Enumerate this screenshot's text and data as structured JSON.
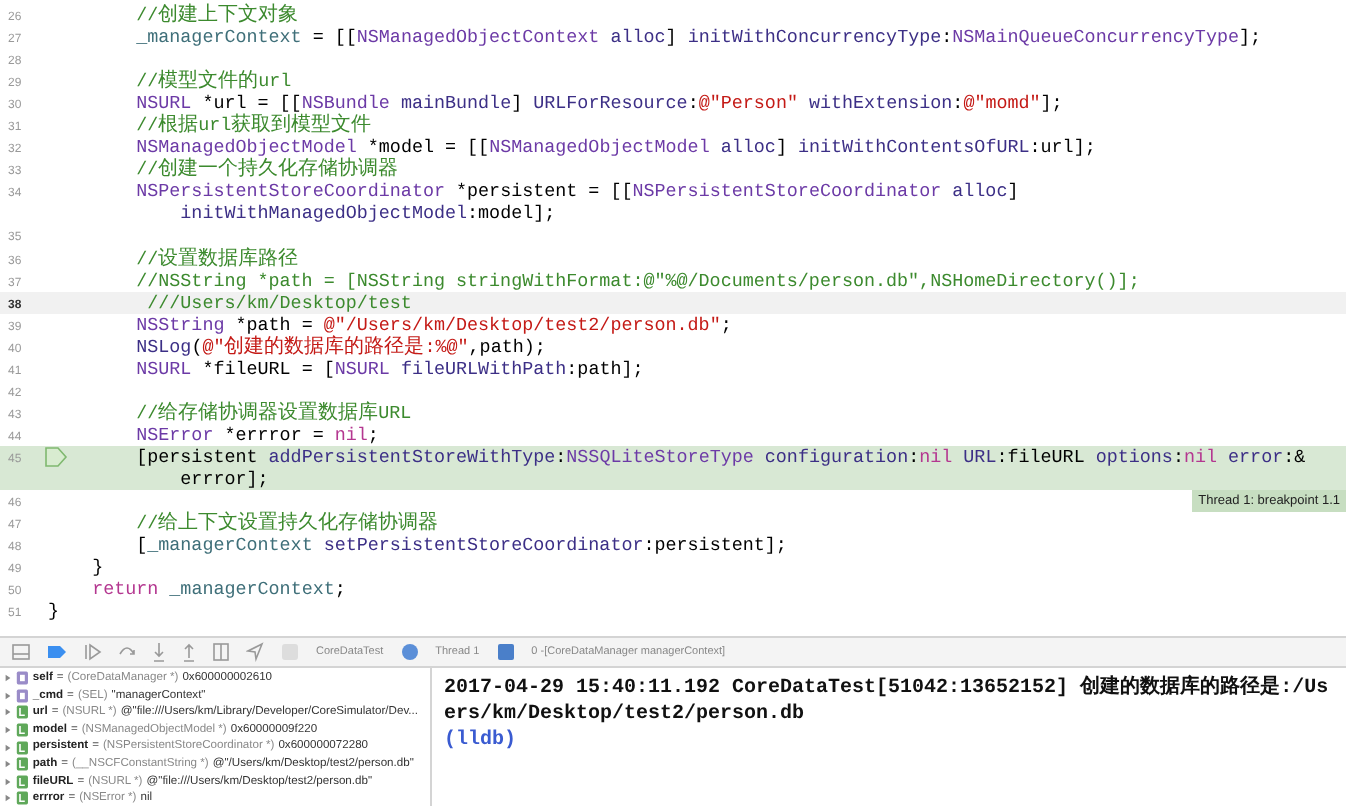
{
  "editor": {
    "lines": [
      {
        "number": "26",
        "current": false,
        "paused": false,
        "segments": [
          {
            "kind": "comment",
            "text": "        //创建上下文对象"
          }
        ]
      },
      {
        "number": "27",
        "current": false,
        "paused": false,
        "segments": [
          {
            "kind": "ivar",
            "text": "        _managerContext"
          },
          {
            "kind": "plain",
            "text": " = [["
          },
          {
            "kind": "type",
            "text": "NSManagedObjectContext"
          },
          {
            "kind": "method",
            "text": " alloc"
          },
          {
            "kind": "plain",
            "text": "] "
          },
          {
            "kind": "method",
            "text": "initWithConcurrencyType"
          },
          {
            "kind": "plain",
            "text": ":"
          },
          {
            "kind": "type",
            "text": "NSMainQueueConcurrencyType"
          },
          {
            "kind": "plain",
            "text": "];"
          }
        ]
      },
      {
        "number": "28",
        "current": false,
        "paused": false
      },
      {
        "number": "29",
        "current": false,
        "paused": false,
        "segments": [
          {
            "kind": "comment",
            "text": "        //模型文件的url"
          }
        ]
      },
      {
        "number": "30",
        "current": false,
        "paused": false,
        "segments": [
          {
            "kind": "type",
            "text": "        NSURL"
          },
          {
            "kind": "plain",
            "text": " *url = [["
          },
          {
            "kind": "type",
            "text": "NSBundle"
          },
          {
            "kind": "method",
            "text": " mainBundle"
          },
          {
            "kind": "plain",
            "text": "] "
          },
          {
            "kind": "method",
            "text": "URLForResource"
          },
          {
            "kind": "plain",
            "text": ":"
          },
          {
            "kind": "string",
            "text": "@\"Person\""
          },
          {
            "kind": "method",
            "text": " withExtension"
          },
          {
            "kind": "plain",
            "text": ":"
          },
          {
            "kind": "string",
            "text": "@\"momd\""
          },
          {
            "kind": "plain",
            "text": "];"
          }
        ]
      },
      {
        "number": "31",
        "current": false,
        "paused": false,
        "segments": [
          {
            "kind": "comment",
            "text": "        //根据url获取到模型文件"
          }
        ]
      },
      {
        "number": "32",
        "current": false,
        "paused": false,
        "segments": [
          {
            "kind": "type",
            "text": "        NSManagedObjectModel"
          },
          {
            "kind": "plain",
            "text": " *model = [["
          },
          {
            "kind": "type",
            "text": "NSManagedObjectModel"
          },
          {
            "kind": "method",
            "text": " alloc"
          },
          {
            "kind": "plain",
            "text": "] "
          },
          {
            "kind": "method",
            "text": "initWithContentsOfURL"
          },
          {
            "kind": "plain",
            "text": ":url];"
          }
        ]
      },
      {
        "number": "33",
        "current": false,
        "paused": false,
        "segments": [
          {
            "kind": "comment",
            "text": "        //创建一个持久化存储协调器"
          }
        ]
      },
      {
        "number": "34",
        "current": false,
        "paused": false,
        "segments": [
          {
            "kind": "type",
            "text": "        NSPersistentStoreCoordinator"
          },
          {
            "kind": "plain",
            "text": " *persistent = [["
          },
          {
            "kind": "type",
            "text": "NSPersistentStoreCoordinator"
          },
          {
            "kind": "method",
            "text": " alloc"
          },
          {
            "kind": "plain",
            "text": "]"
          }
        ],
        "wrapped": [
          {
            "kind": "method",
            "text": "            initWithManagedObjectModel"
          },
          {
            "kind": "plain",
            "text": ":model];"
          }
        ]
      },
      {
        "number": "35",
        "current": false,
        "paused": false
      },
      {
        "number": "36",
        "current": false,
        "paused": false,
        "segments": [
          {
            "kind": "comment",
            "text": "        //设置数据库路径"
          }
        ]
      },
      {
        "number": "37",
        "current": false,
        "paused": false,
        "segments": [
          {
            "kind": "comment",
            "text": "        //NSString *path = [NSString stringWithFormat:@\"%@/Documents/person.db\",NSHomeDirectory()];"
          }
        ]
      },
      {
        "number": "38",
        "current": true,
        "paused": false,
        "segments": [
          {
            "kind": "comment",
            "text": "         ///Users/km/Desktop/test"
          }
        ]
      },
      {
        "number": "39",
        "current": false,
        "paused": false,
        "segments": [
          {
            "kind": "type",
            "text": "        NSString"
          },
          {
            "kind": "plain",
            "text": " *path = "
          },
          {
            "kind": "string",
            "text": "@\"/Users/km/Desktop/test2/person.db\""
          },
          {
            "kind": "plain",
            "text": ";"
          }
        ]
      },
      {
        "number": "40",
        "current": false,
        "paused": false,
        "segments": [
          {
            "kind": "method",
            "text": "        NSLog"
          },
          {
            "kind": "plain",
            "text": "("
          },
          {
            "kind": "string",
            "text": "@\"创建的数据库的路径是:%@\""
          },
          {
            "kind": "plain",
            "text": ",path);"
          }
        ]
      },
      {
        "number": "41",
        "current": false,
        "paused": false,
        "segments": [
          {
            "kind": "type",
            "text": "        NSURL"
          },
          {
            "kind": "plain",
            "text": " *fileURL = ["
          },
          {
            "kind": "type",
            "text": "NSURL"
          },
          {
            "kind": "method",
            "text": " fileURLWithPath"
          },
          {
            "kind": "plain",
            "text": ":path];"
          }
        ]
      },
      {
        "number": "42",
        "current": false,
        "paused": false
      },
      {
        "number": "43",
        "current": false,
        "paused": false,
        "segments": [
          {
            "kind": "comment",
            "text": "        //给存储协调器设置数据库URL"
          }
        ]
      },
      {
        "number": "44",
        "current": false,
        "paused": false,
        "segments": [
          {
            "kind": "type",
            "text": "        NSError"
          },
          {
            "kind": "plain",
            "text": " *errror = "
          },
          {
            "kind": "keyword",
            "text": "nil"
          },
          {
            "kind": "plain",
            "text": ";"
          }
        ]
      },
      {
        "number": "45",
        "current": false,
        "paused": true,
        "segments": [
          {
            "kind": "plain",
            "text": "        [persistent "
          },
          {
            "kind": "method",
            "text": "addPersistentStoreWithType"
          },
          {
            "kind": "plain",
            "text": ":"
          },
          {
            "kind": "type",
            "text": "NSSQLiteStoreType"
          },
          {
            "kind": "method",
            "text": " configuration"
          },
          {
            "kind": "plain",
            "text": ":"
          },
          {
            "kind": "keyword",
            "text": "nil"
          },
          {
            "kind": "method",
            "text": " URL"
          },
          {
            "kind": "plain",
            "text": ":fileURL "
          },
          {
            "kind": "method",
            "text": "options"
          },
          {
            "kind": "plain",
            "text": ":"
          },
          {
            "kind": "keyword",
            "text": "nil"
          },
          {
            "kind": "method",
            "text": " error"
          },
          {
            "kind": "plain",
            "text": ":&"
          }
        ],
        "wrapped": [
          {
            "kind": "plain",
            "text": "            errror];"
          }
        ]
      },
      {
        "number": "46",
        "current": false,
        "paused": false,
        "annotation": "Thread 1: breakpoint 1.1"
      },
      {
        "number": "47",
        "current": false,
        "paused": false,
        "segments": [
          {
            "kind": "comment",
            "text": "        //给上下文设置持久化存储协调器"
          }
        ]
      },
      {
        "number": "48",
        "current": false,
        "paused": false,
        "segments": [
          {
            "kind": "plain",
            "text": "        ["
          },
          {
            "kind": "ivar",
            "text": "_managerContext"
          },
          {
            "kind": "method",
            "text": " setPersistentStoreCoordinator"
          },
          {
            "kind": "plain",
            "text": ":persistent];"
          }
        ]
      },
      {
        "number": "49",
        "current": false,
        "paused": false,
        "segments": [
          {
            "kind": "plain",
            "text": "    }"
          }
        ]
      },
      {
        "number": "50",
        "current": false,
        "paused": false,
        "segments": [
          {
            "kind": "keyword",
            "text": "    return"
          },
          {
            "kind": "ivar",
            "text": " _managerContext"
          },
          {
            "kind": "plain",
            "text": ";"
          }
        ]
      },
      {
        "number": "51",
        "current": false,
        "paused": false,
        "segments": [
          {
            "kind": "plain",
            "text": "}"
          }
        ]
      }
    ]
  },
  "debug_bar": {
    "breakpoints_active": true,
    "breadcrumbs": [
      "CoreDataTest",
      "Thread 1",
      "0 -[CoreDataManager managerContext]"
    ]
  },
  "variables": [
    {
      "kind": "argument",
      "name": "self",
      "equals": "=",
      "type": "(CoreDataManager *)",
      "value": "0x600000002610"
    },
    {
      "kind": "argument",
      "name": "_cmd",
      "equals": "=",
      "type": "(SEL)",
      "value": "\"managerContext\""
    },
    {
      "kind": "local",
      "name": "url",
      "equals": "=",
      "type": "(NSURL *)",
      "value": "@\"file:///Users/km/Library/Developer/CoreSimulator/Dev..."
    },
    {
      "kind": "local",
      "name": "model",
      "equals": "=",
      "type": "(NSManagedObjectModel *)",
      "value": "0x60000009f220"
    },
    {
      "kind": "local",
      "name": "persistent",
      "equals": "=",
      "type": "(NSPersistentStoreCoordinator *)",
      "value": "0x600000072280"
    },
    {
      "kind": "local",
      "name": "path",
      "equals": "=",
      "type": "(__NSCFConstantString *)",
      "value": "@\"/Users/km/Desktop/test2/person.db\""
    },
    {
      "kind": "local",
      "name": "fileURL",
      "equals": "=",
      "type": "(NSURL *)",
      "value": "@\"file:///Users/km/Desktop/test2/person.db\""
    },
    {
      "kind": "local",
      "name": "errror",
      "equals": "=",
      "type": "(NSError *)",
      "value": "nil"
    }
  ],
  "console": {
    "output": "2017-04-29 15:40:11.192 CoreDataTest[51042:13652152] 创建的数据库的路径是:/Users/km/Desktop/test2/person.db",
    "prompt": "(lldb)"
  }
}
